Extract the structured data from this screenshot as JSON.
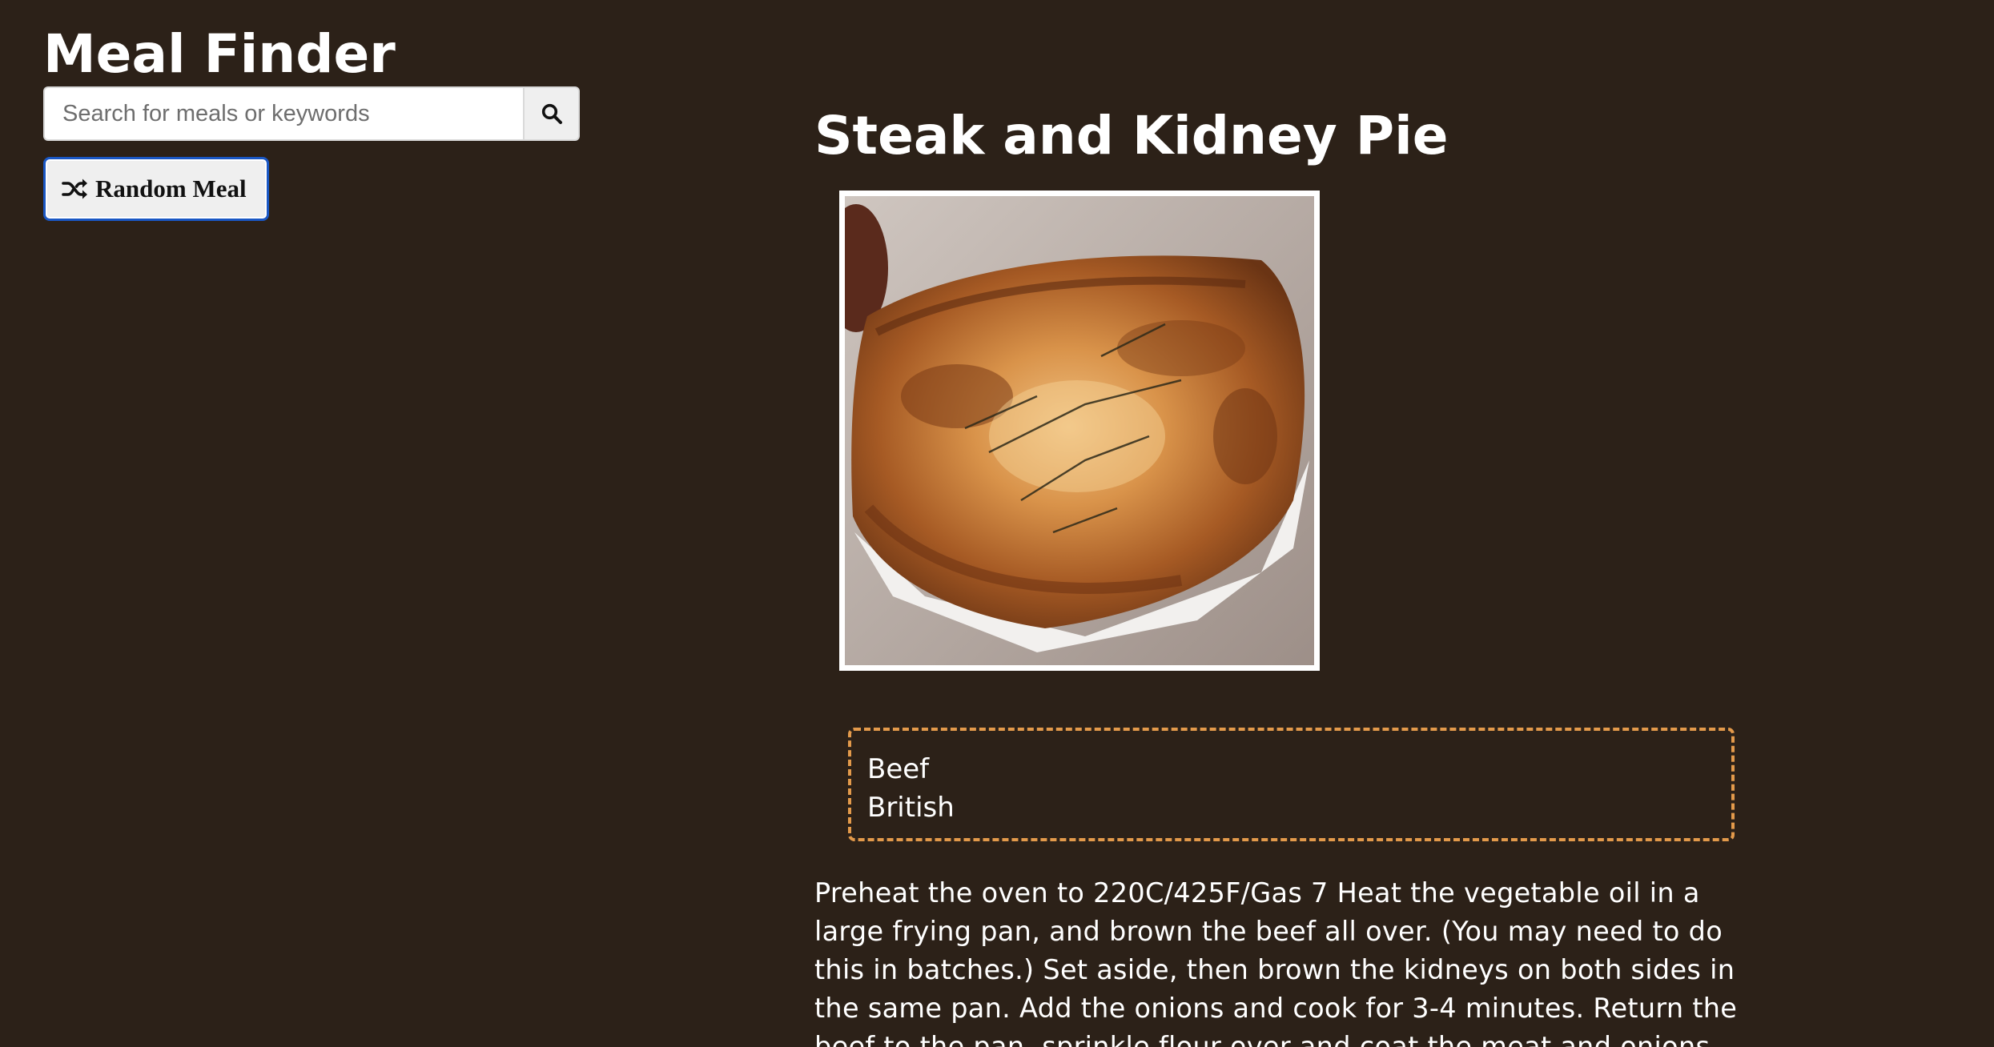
{
  "header": {
    "title": "Meal Finder"
  },
  "search": {
    "placeholder": "Search for meals or keywords",
    "value": "",
    "button_icon": "search-icon"
  },
  "random": {
    "label": "Random Meal",
    "icon": "shuffle-icon"
  },
  "meal": {
    "title": "Steak and Kidney Pie",
    "image_alt": "Steak and Kidney Pie",
    "category": "Beef",
    "area": "British",
    "instructions": "Preheat the oven to 220C/425F/Gas 7 Heat the vegetable oil in a large frying pan, and brown the beef all over. (You may need to do this in batches.) Set aside, then brown the kidneys on both sides in the same pan. Add the onions and cook for 3-4 minutes. Return the beef to the pan, sprinkle flour over and coat the meat and onions"
  },
  "colors": {
    "background": "#2c2118",
    "text": "#ffffff",
    "info_border": "#e39a4b",
    "focus_ring": "#1a57c4"
  }
}
